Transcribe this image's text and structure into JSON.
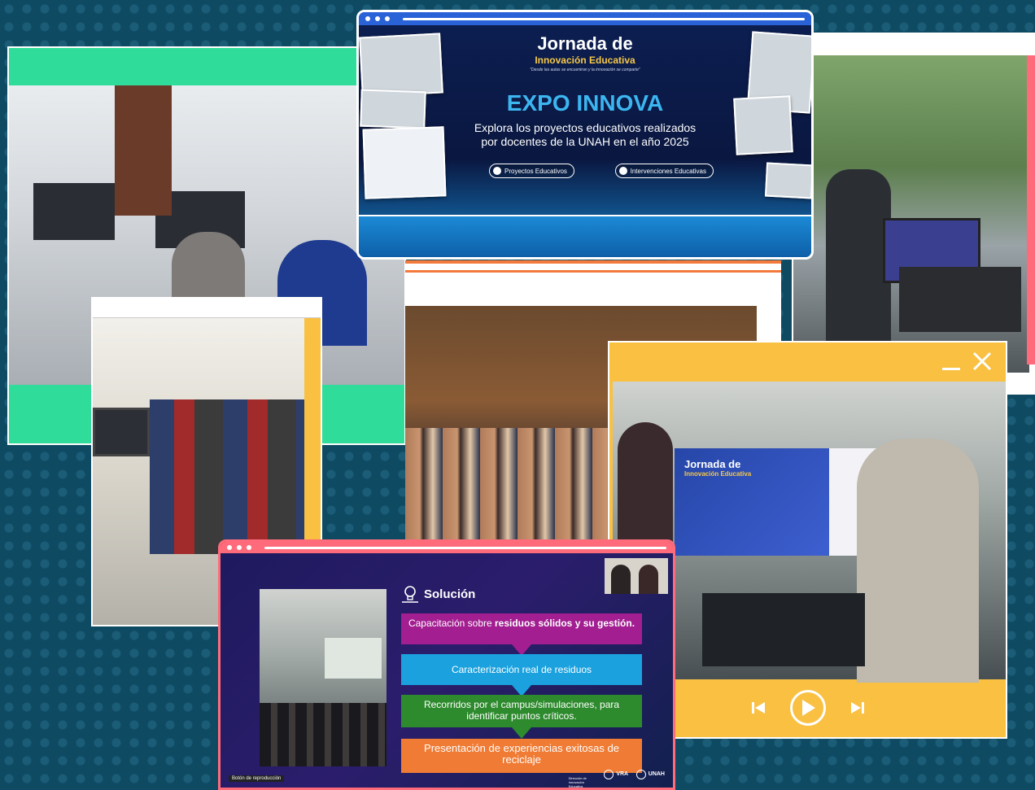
{
  "expo_banner": {
    "jornada_title": "Jornada de",
    "jornada_subtitle": "Innovación Educativa",
    "jornada_tagline": "\"Desde las aulas se encuentran y la innovación se comparte\"",
    "expo_title": "EXPO INNOVA",
    "description_line1": "Explora los proyectos educativos realizados",
    "description_line2": "por docentes de la UNAH en el año 2025",
    "buttons": [
      {
        "label": "Proyectos Educativos"
      },
      {
        "label": "Intervenciones Educativas"
      }
    ]
  },
  "solucion_window": {
    "heading": "Solución",
    "steps": [
      {
        "prefix": "Capacitación  sobre ",
        "bold": "residuos sólidos y su gestión.",
        "color": "#a21e91"
      },
      {
        "prefix": "Caracterización  real de residuos",
        "bold": "",
        "color": "#1aa1de"
      },
      {
        "prefix": "Recorridos por el campus/simulaciones, para identificar puntos críticos.",
        "bold": "",
        "color": "#2d8a2d"
      },
      {
        "prefix": "Presentación de experiencias exitosas de reciclaje",
        "bold": "",
        "color": "#ef7b34"
      }
    ],
    "footer_left": "Botón de reproducción",
    "logos": [
      "Dirección de Innovación Educativa",
      "VRA",
      "UNAH"
    ]
  },
  "player_slide": {
    "jornada_title": "Jornada de",
    "jornada_subtitle": "Innovación Educativa"
  },
  "colors": {
    "background": "#0f4a63",
    "accent_teal": "#2fdc9a",
    "accent_yellow": "#f9c042",
    "accent_pink": "#ff6b7a",
    "accent_blue": "#2a62d8"
  }
}
